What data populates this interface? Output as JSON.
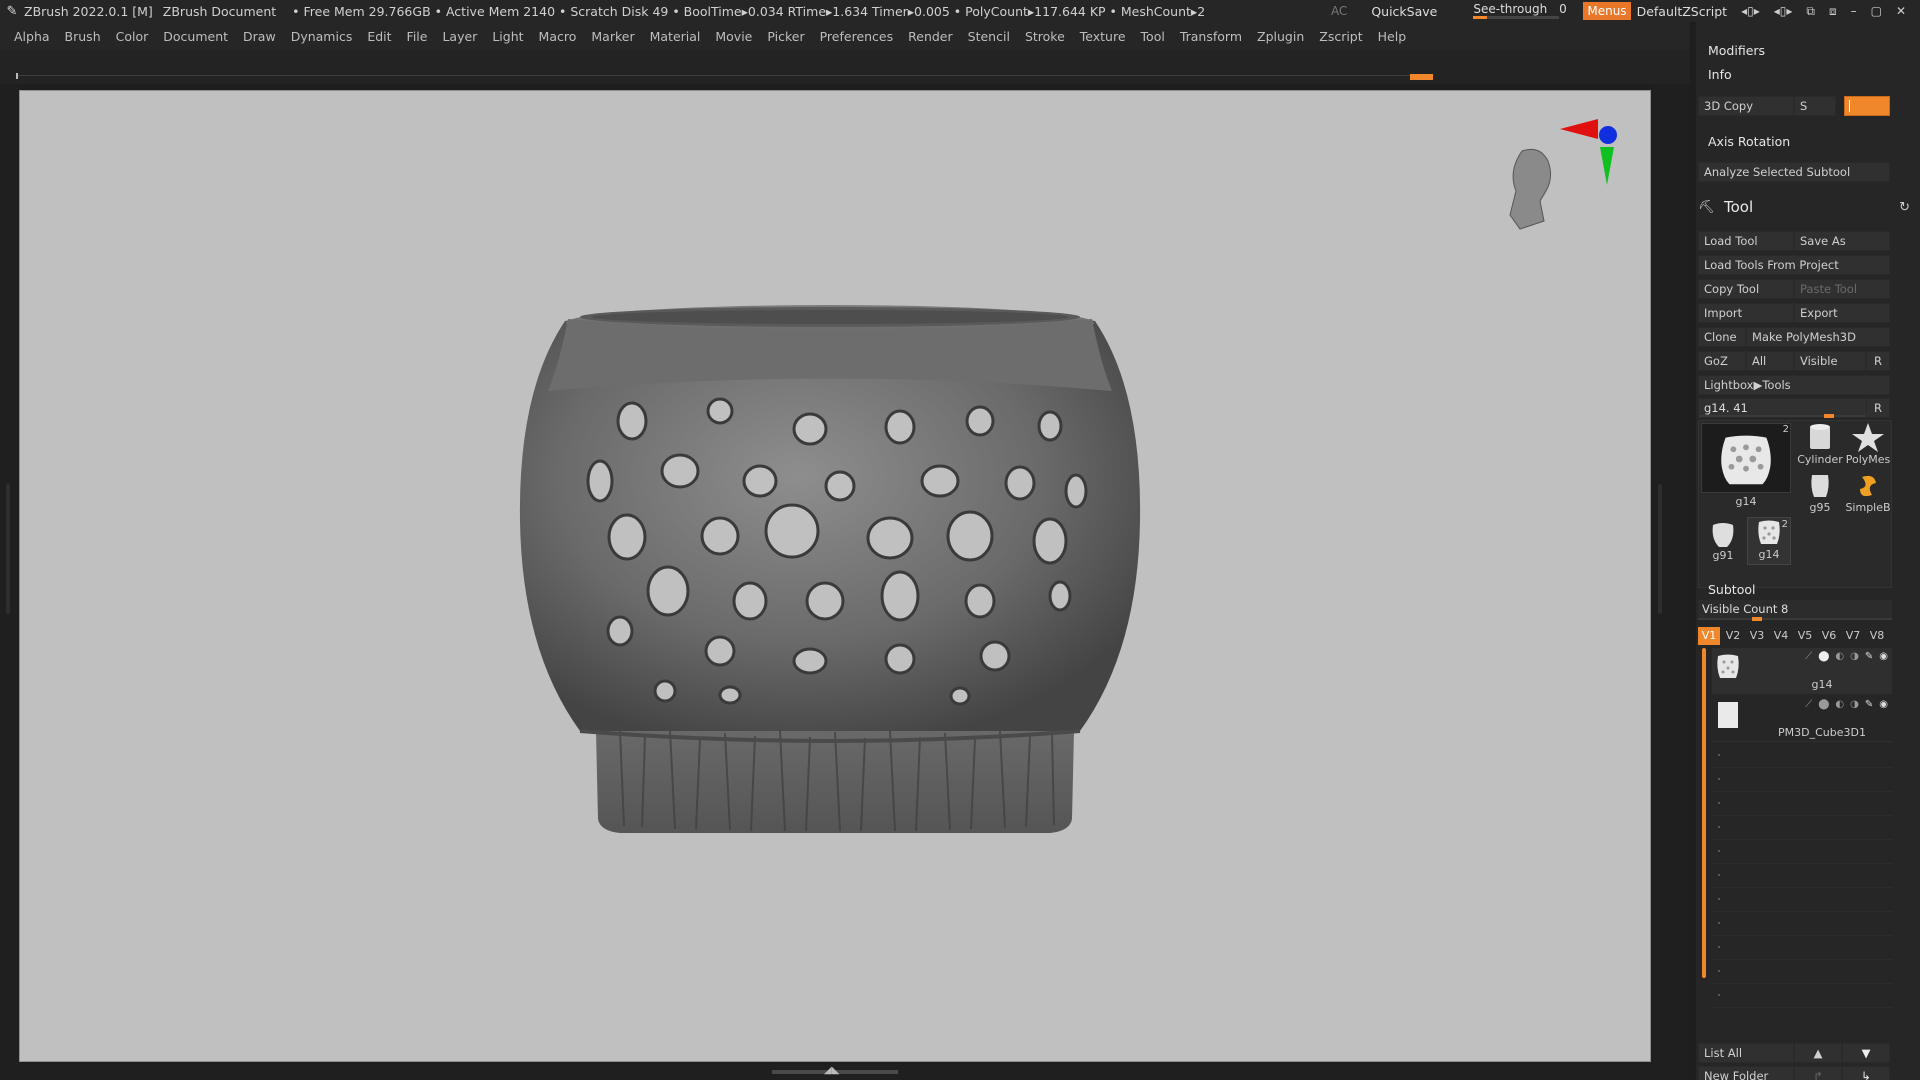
{
  "titlebar": {
    "app": "ZBrush 2022.0.1 [M]",
    "document": "ZBrush Document",
    "stats": "• Free Mem 29.766GB • Active Mem 2140 • Scratch Disk 49 •  BoolTime▸0.034 RTime▸1.634 Timer▸0.005 • PolyCount▸117.644 KP  • MeshCount▸2",
    "ac": "AC",
    "quicksave": "QuickSave",
    "see_through_label": "See-through",
    "see_through_value": "0",
    "menus": "Menus",
    "script": "DefaultZScript"
  },
  "menubar": [
    "Alpha",
    "Brush",
    "Color",
    "Document",
    "Draw",
    "Dynamics",
    "Edit",
    "File",
    "Layer",
    "Light",
    "Macro",
    "Marker",
    "Material",
    "Movie",
    "Picker",
    "Preferences",
    "Render",
    "Stencil",
    "Stroke",
    "Texture",
    "Tool",
    "Transform",
    "Zplugin",
    "Zscript",
    "Help"
  ],
  "colors": {
    "accent": "#f0872b",
    "canvas_bg": "#c0c0c0",
    "ui_bg": "#262626",
    "gizmo_red": "#e01010",
    "gizmo_green": "#10c020",
    "gizmo_blue": "#1030e0"
  },
  "panel": {
    "modifiers": "Modifiers",
    "info": "Info",
    "copy3d": "3D Copy",
    "s_label": "S",
    "axis_rotation": "Axis Rotation",
    "analyze": "Analyze Selected Subtool",
    "tool_title": "Tool",
    "load_tool": "Load Tool",
    "save_as": "Save As",
    "load_from_project": "Load Tools From Project",
    "copy_tool": "Copy Tool",
    "paste_tool": "Paste Tool",
    "import": "Import",
    "export": "Export",
    "clone": "Clone",
    "make_polymesh": "Make PolyMesh3D",
    "goz": "GoZ",
    "all": "All",
    "visible": "Visible",
    "r": "R",
    "lightbox_tools": "Lightbox▶Tools",
    "current_tool": "g14. 41",
    "current_tool_slider": 0.66,
    "thumbs": [
      {
        "name": "g14",
        "badge": "2"
      },
      {
        "name": "Cylinder"
      },
      {
        "name": "PolyMes"
      },
      {
        "name": "g95"
      },
      {
        "name": "SimpleB"
      },
      {
        "name": "g91"
      },
      {
        "name": "g14",
        "badge": "2"
      }
    ],
    "subtool_hdr": "Subtool",
    "visible_count": "Visible Count 8",
    "visible_count_slider": 0.28,
    "vtabs": [
      "V1",
      "V2",
      "V3",
      "V4",
      "V5",
      "V6",
      "V7",
      "V8"
    ],
    "subtools": [
      {
        "name": "g14"
      },
      {
        "name": "PM3D_Cube3D1"
      }
    ],
    "list_all": "List All",
    "new_folder": "New Folder"
  }
}
